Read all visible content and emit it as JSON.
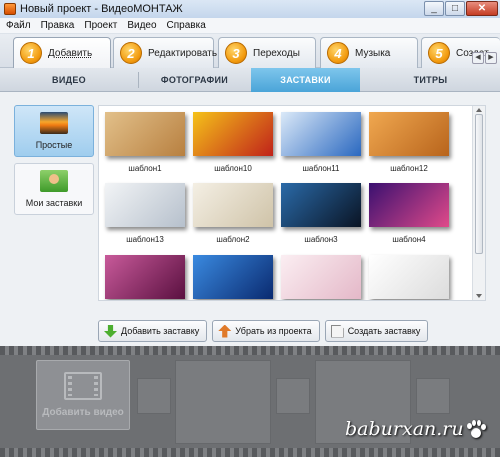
{
  "window": {
    "title": "Новый проект - ВидеоМОНТАЖ"
  },
  "menu": [
    "Файл",
    "Правка",
    "Проект",
    "Видео",
    "Справка"
  ],
  "steps": [
    {
      "num": "1",
      "label": "Добавить",
      "active": true
    },
    {
      "num": "2",
      "label": "Редактировать",
      "active": false
    },
    {
      "num": "3",
      "label": "Переходы",
      "active": false
    },
    {
      "num": "4",
      "label": "Музыка",
      "active": false
    },
    {
      "num": "5",
      "label": "Создат",
      "active": false
    }
  ],
  "subtabs": [
    "ВИДЕО",
    "ФОТОГРАФИИ",
    "ЗАСТАВКИ",
    "ТИТРЫ"
  ],
  "active_subtab": "ЗАСТАВКИ",
  "categories": [
    {
      "label": "Простые",
      "icon": "sunset-icon",
      "active": true
    },
    {
      "label": "Мои заставки",
      "icon": "person-icon",
      "active": false
    }
  ],
  "templates": [
    {
      "label": "шаблон1",
      "colors": [
        "#e2c08a",
        "#b88040"
      ]
    },
    {
      "label": "шаблон10",
      "colors": [
        "#f5c21a",
        "#c0221a"
      ]
    },
    {
      "label": "шаблон11",
      "colors": [
        "#dbe9f8",
        "#2a68c0"
      ]
    },
    {
      "label": "шаблон12",
      "colors": [
        "#f0a850",
        "#b8641c"
      ]
    },
    {
      "label": "шаблон13",
      "colors": [
        "#f2f4f6",
        "#b6c0cc"
      ]
    },
    {
      "label": "шаблон2",
      "colors": [
        "#f4efe4",
        "#cfc3a8"
      ]
    },
    {
      "label": "шаблон3",
      "colors": [
        "#2a6aa8",
        "#0a1424"
      ]
    },
    {
      "label": "шаблон4",
      "colors": [
        "#3a1070",
        "#e04a8a"
      ]
    },
    {
      "label": "",
      "colors": [
        "#c85a9a",
        "#5a1040"
      ]
    },
    {
      "label": "",
      "colors": [
        "#3a8ae0",
        "#0a2a70"
      ]
    },
    {
      "label": "",
      "colors": [
        "#fbeef2",
        "#e4b8c8"
      ]
    },
    {
      "label": "",
      "colors": [
        "#ffffff",
        "#dcdcdc"
      ]
    }
  ],
  "actions": {
    "add": "Добавить заставку",
    "remove": "Убрать из проекта",
    "create": "Создать заставку"
  },
  "timeline": {
    "add_video": "Добавить видео"
  },
  "watermark": "baburxan.ru",
  "colors": {
    "accent": "#4aa4d8",
    "step_orange": "#f29a0e",
    "timeline": "#6d6f72"
  }
}
